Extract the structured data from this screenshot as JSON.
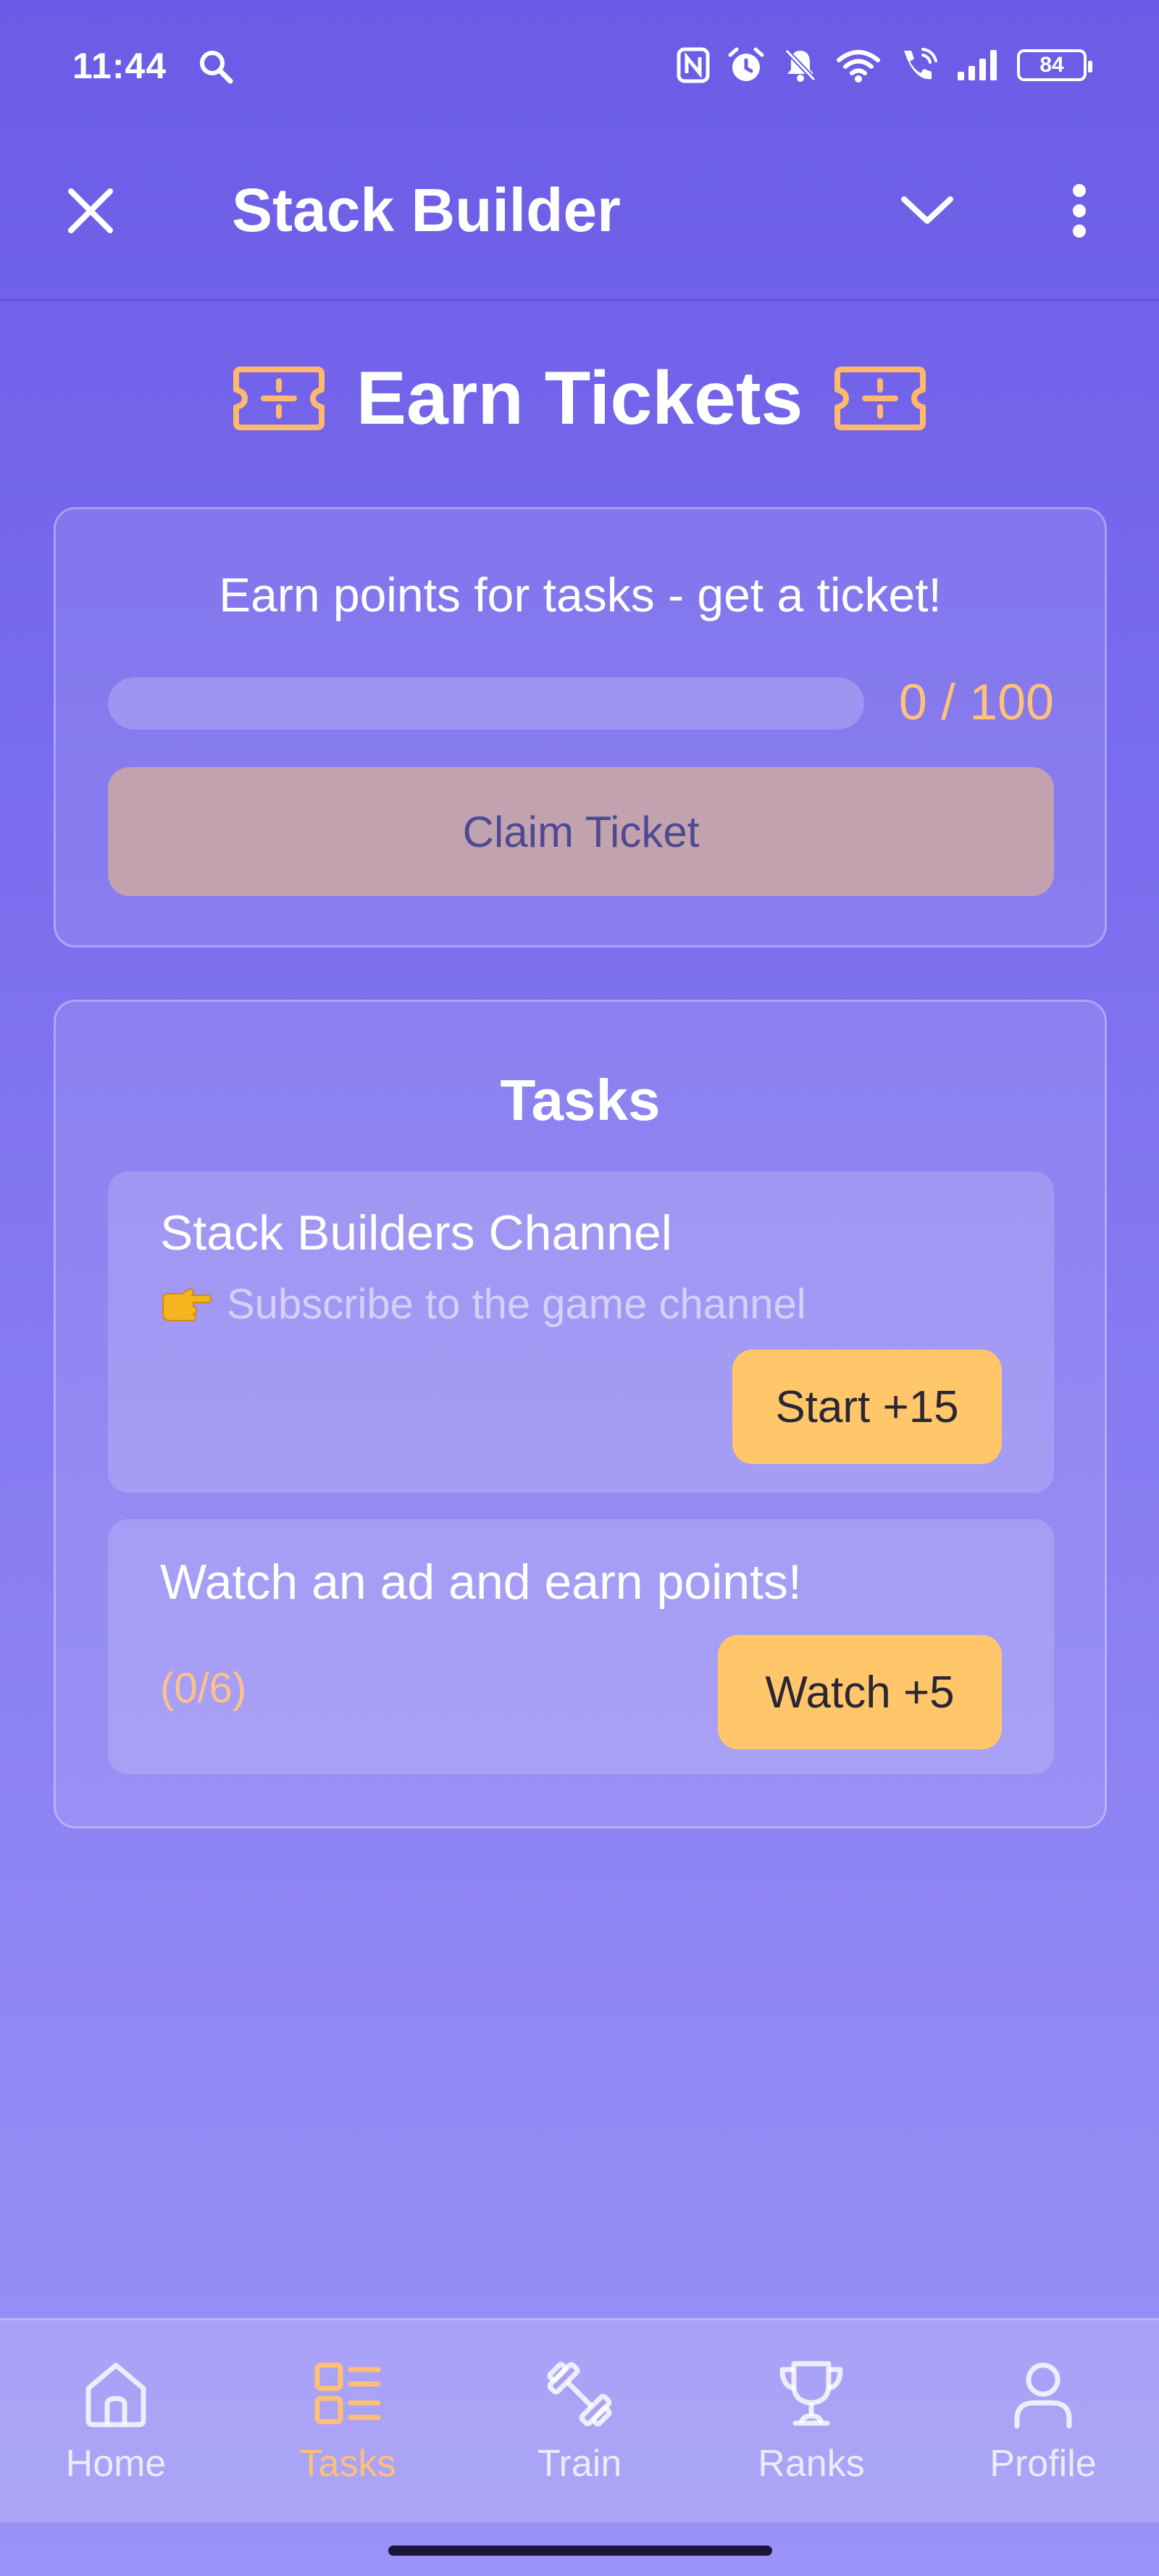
{
  "status_bar": {
    "time": "11:44",
    "battery": "84",
    "icons": [
      "search-icon",
      "nfc-icon",
      "alarm-icon",
      "bell-off-icon",
      "wifi-icon",
      "wifi-call-icon",
      "signal-icon",
      "battery-icon"
    ]
  },
  "header": {
    "title": "Stack Builder",
    "icons": [
      "close-icon",
      "chevron-down-icon",
      "more-vertical-icon"
    ]
  },
  "page": {
    "title": "Earn Tickets",
    "title_icon": "ticket-icon"
  },
  "earn_card": {
    "subtitle": "Earn points for tasks - get a ticket!",
    "progress_current": 0,
    "progress_max": 100,
    "progress_text": "0 / 100",
    "claim_label": "Claim Ticket"
  },
  "tasks_card": {
    "title": "Tasks",
    "items": [
      {
        "name": "Stack Builders Channel",
        "description": "Subscribe to the game channel",
        "description_icon": "pointing-hand-icon",
        "button_label": "Start +15"
      },
      {
        "name": "Watch an ad and earn points!",
        "progress": "(0/6)",
        "button_label": "Watch +5"
      }
    ]
  },
  "bottom_nav": {
    "active": "Tasks",
    "items": [
      {
        "label": "Home",
        "icon": "home-icon"
      },
      {
        "label": "Tasks",
        "icon": "tasks-icon"
      },
      {
        "label": "Train",
        "icon": "dumbbell-icon"
      },
      {
        "label": "Ranks",
        "icon": "trophy-icon"
      },
      {
        "label": "Profile",
        "icon": "profile-icon"
      }
    ]
  },
  "colors": {
    "accent": "#ffc76a",
    "accent_text": "#ffbf76",
    "background_top": "#6b5be6",
    "background_bottom": "#9a92f6",
    "claim_button": "#c2a2ae"
  }
}
